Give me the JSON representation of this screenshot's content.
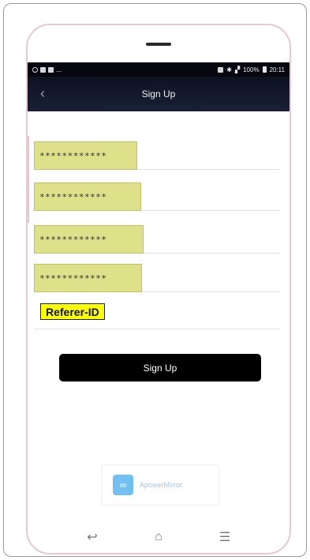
{
  "status_bar": {
    "left_icons": [
      "whatsapp-icon",
      "message-icon",
      "chat-icon"
    ],
    "more": "...",
    "battery": "100%",
    "time": "20:11"
  },
  "app_bar": {
    "back_icon": "chevron-left-icon",
    "title": "Sign Up"
  },
  "form": {
    "fields": [
      {
        "value": "************"
      },
      {
        "value": "************"
      },
      {
        "value": "************"
      },
      {
        "value": "************"
      }
    ],
    "referer_label": "Referer-ID",
    "submit_label": "Sign Up"
  },
  "watermark": {
    "text": "ApowerMirror"
  },
  "nav_bar": {
    "back": "↩",
    "home": "⌂",
    "menu": "☰"
  },
  "colors": {
    "header_bg": "#0d1222",
    "field_highlight": "#dfe08a",
    "referer_highlight": "#fbff00",
    "button_bg": "#000000"
  }
}
